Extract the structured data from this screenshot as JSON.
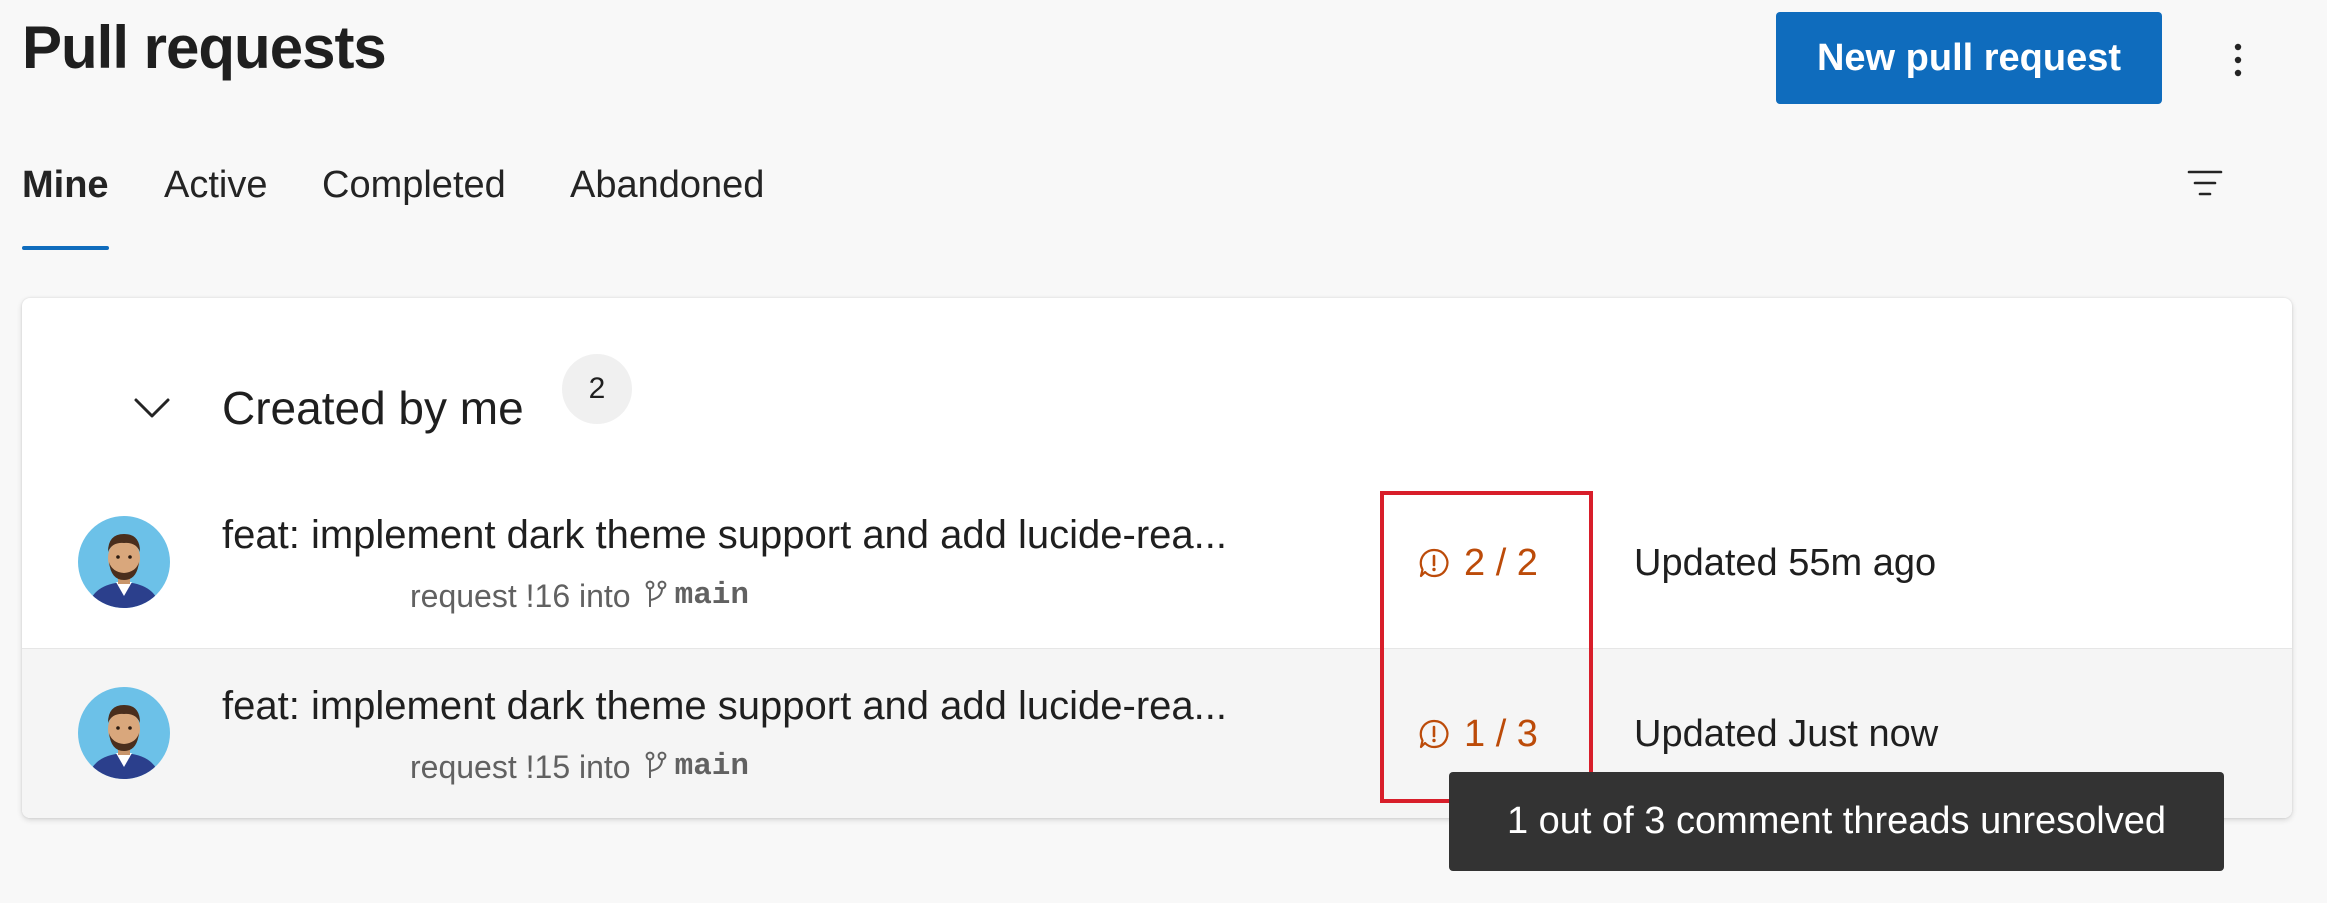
{
  "header": {
    "title": "Pull requests",
    "new_button_label": "New pull request",
    "more_icon": "more-vertical-icon"
  },
  "tabs": [
    {
      "label": "Mine",
      "active": true
    },
    {
      "label": "Active",
      "active": false
    },
    {
      "label": "Completed",
      "active": false
    },
    {
      "label": "Abandoned",
      "active": false
    }
  ],
  "filter_icon": "filter-icon",
  "group": {
    "toggle_icon": "chevron-down-icon",
    "title": "Created by me",
    "count": "2"
  },
  "pull_requests": [
    {
      "title": "feat: implement dark theme support and add lucide-rea...",
      "subtitle_prefix": "request !16 into",
      "target_branch": "main",
      "comments": "2 / 2",
      "updated": "Updated 55m ago"
    },
    {
      "title": "feat: implement dark theme support and add lucide-rea...",
      "subtitle_prefix": "request !15 into",
      "target_branch": "main",
      "comments": "1 / 3",
      "updated": "Updated Just now"
    }
  ],
  "tooltip": {
    "text": "1 out of 3 comment threads unresolved"
  },
  "colors": {
    "accent": "#0f6cbd",
    "comment_warning": "#bc4b09",
    "highlight": "#d81e2a",
    "tooltip_bg": "#333333"
  }
}
